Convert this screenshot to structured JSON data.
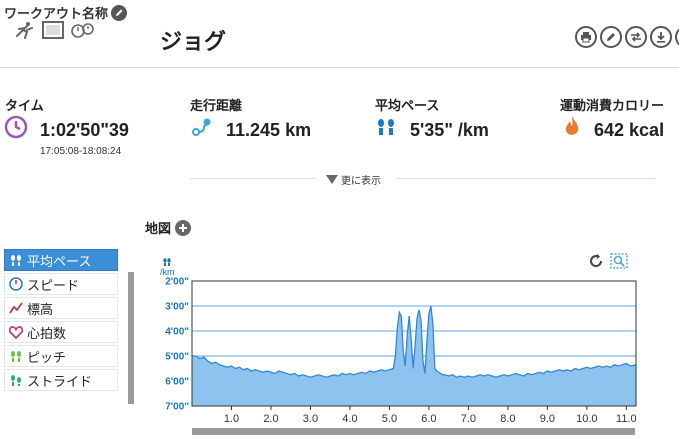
{
  "header": {
    "workout_name_label": "ワークアウト名称",
    "title": "ジョグ",
    "activity_icons": [
      "runner-icon",
      "video-icon",
      "stopwatch-icon"
    ],
    "tool_icons": [
      "print-icon",
      "edit-icon",
      "swap-icon",
      "download-icon",
      "pencil-icon"
    ]
  },
  "stats": {
    "time": {
      "label": "タイム",
      "value": "1:02'50\"39",
      "range": "17:05:08-18:08:24",
      "icon": "clock-icon",
      "color": "#9b59b6"
    },
    "distance": {
      "label": "走行距離",
      "value": "11.245 km",
      "icon": "route-icon",
      "color": "#3aa6d8"
    },
    "pace": {
      "label": "平均ペース",
      "value": "5'35\" /km",
      "icon": "footprints-icon",
      "color": "#1f7ac4"
    },
    "calories": {
      "label": "運動消費カロリー",
      "value": "642 kcal",
      "icon": "flame-icon",
      "color": "#e87a2a"
    }
  },
  "more_label": "更に表示",
  "map": {
    "label": "地図"
  },
  "metrics": [
    {
      "label": "平均ペース",
      "icon": "footprints-icon",
      "active": true
    },
    {
      "label": "スピード",
      "icon": "speedometer-icon",
      "active": false
    },
    {
      "label": "標高",
      "icon": "elevation-icon",
      "active": false
    },
    {
      "label": "心拍数",
      "icon": "heart-icon",
      "active": false
    },
    {
      "label": "ピッチ",
      "icon": "footprints-icon",
      "active": false
    },
    {
      "label": "ストライド",
      "icon": "footprints-icon",
      "active": false
    }
  ],
  "chart_data": {
    "type": "area",
    "unit": "/km",
    "x": [
      0.0,
      0.1,
      0.2,
      0.3,
      0.4,
      0.5,
      0.6,
      0.7,
      0.8,
      0.9,
      1.0,
      1.1,
      1.2,
      1.3,
      1.4,
      1.5,
      1.6,
      1.7,
      1.8,
      1.9,
      2.0,
      2.1,
      2.2,
      2.3,
      2.4,
      2.5,
      2.6,
      2.7,
      2.8,
      2.9,
      3.0,
      3.1,
      3.2,
      3.3,
      3.4,
      3.5,
      3.6,
      3.7,
      3.8,
      3.9,
      4.0,
      4.1,
      4.2,
      4.3,
      4.4,
      4.5,
      4.6,
      4.7,
      4.8,
      4.9,
      5.0,
      5.1,
      5.15,
      5.2,
      5.25,
      5.3,
      5.35,
      5.4,
      5.45,
      5.5,
      5.55,
      5.6,
      5.65,
      5.7,
      5.75,
      5.8,
      5.85,
      5.9,
      5.95,
      6.0,
      6.05,
      6.1,
      6.15,
      6.2,
      6.25,
      6.3,
      6.35,
      6.4,
      6.5,
      6.6,
      6.7,
      6.8,
      6.9,
      7.0,
      7.1,
      7.2,
      7.3,
      7.4,
      7.5,
      7.6,
      7.7,
      7.8,
      7.9,
      8.0,
      8.1,
      8.2,
      8.3,
      8.4,
      8.5,
      8.6,
      8.7,
      8.8,
      8.9,
      9.0,
      9.1,
      9.2,
      9.3,
      9.4,
      9.5,
      9.6,
      9.7,
      9.8,
      9.9,
      10.0,
      10.1,
      10.2,
      10.3,
      10.4,
      10.5,
      10.6,
      10.7,
      10.8,
      10.9,
      11.0,
      11.1,
      11.245
    ],
    "y_min_per_km": [
      5.0,
      5.0,
      5.1,
      5.05,
      5.2,
      5.3,
      5.25,
      5.35,
      5.4,
      5.45,
      5.4,
      5.5,
      5.45,
      5.55,
      5.5,
      5.6,
      5.55,
      5.6,
      5.65,
      5.6,
      5.65,
      5.7,
      5.6,
      5.65,
      5.7,
      5.75,
      5.7,
      5.8,
      5.75,
      5.8,
      5.85,
      5.8,
      5.75,
      5.8,
      5.85,
      5.8,
      5.75,
      5.8,
      5.7,
      5.75,
      5.7,
      5.75,
      5.7,
      5.65,
      5.7,
      5.6,
      5.65,
      5.6,
      5.55,
      5.6,
      5.55,
      5.5,
      5.0,
      3.9,
      3.25,
      3.4,
      4.8,
      5.4,
      4.2,
      3.4,
      4.3,
      5.5,
      4.6,
      3.5,
      3.15,
      3.6,
      5.2,
      5.7,
      4.4,
      3.3,
      3.0,
      3.7,
      5.5,
      5.6,
      5.65,
      5.7,
      5.75,
      5.75,
      5.8,
      5.75,
      5.85,
      5.8,
      5.85,
      5.8,
      5.85,
      5.8,
      5.75,
      5.8,
      5.75,
      5.8,
      5.85,
      5.8,
      5.75,
      5.8,
      5.75,
      5.7,
      5.75,
      5.8,
      5.7,
      5.75,
      5.7,
      5.65,
      5.7,
      5.6,
      5.65,
      5.6,
      5.55,
      5.6,
      5.55,
      5.6,
      5.5,
      5.55,
      5.5,
      5.45,
      5.5,
      5.45,
      5.4,
      5.45,
      5.4,
      5.45,
      5.35,
      5.4,
      5.35,
      5.3,
      5.4,
      5.35
    ],
    "y_ticks": [
      "2'00\"",
      "3'00\"",
      "4'00\"",
      "5'00\"",
      "6'00\"",
      "7'00\""
    ],
    "y_tick_values": [
      2,
      3,
      4,
      5,
      6,
      7
    ],
    "x_ticks": [
      "1.0",
      "2.0",
      "3.0",
      "4.0",
      "5.0",
      "6.0",
      "7.0",
      "8.0",
      "9.0",
      "10.0",
      "11.0"
    ],
    "x_tick_values": [
      1,
      2,
      3,
      4,
      5,
      6,
      7,
      8,
      9,
      10,
      11
    ],
    "xlim": [
      0,
      11.245
    ],
    "ylim": [
      2,
      7
    ],
    "y_inverted": true,
    "grid": true,
    "line_color": "#2f88d6",
    "fill_color": "#8ec2ef",
    "axis_label_color": "#1b73c0"
  }
}
